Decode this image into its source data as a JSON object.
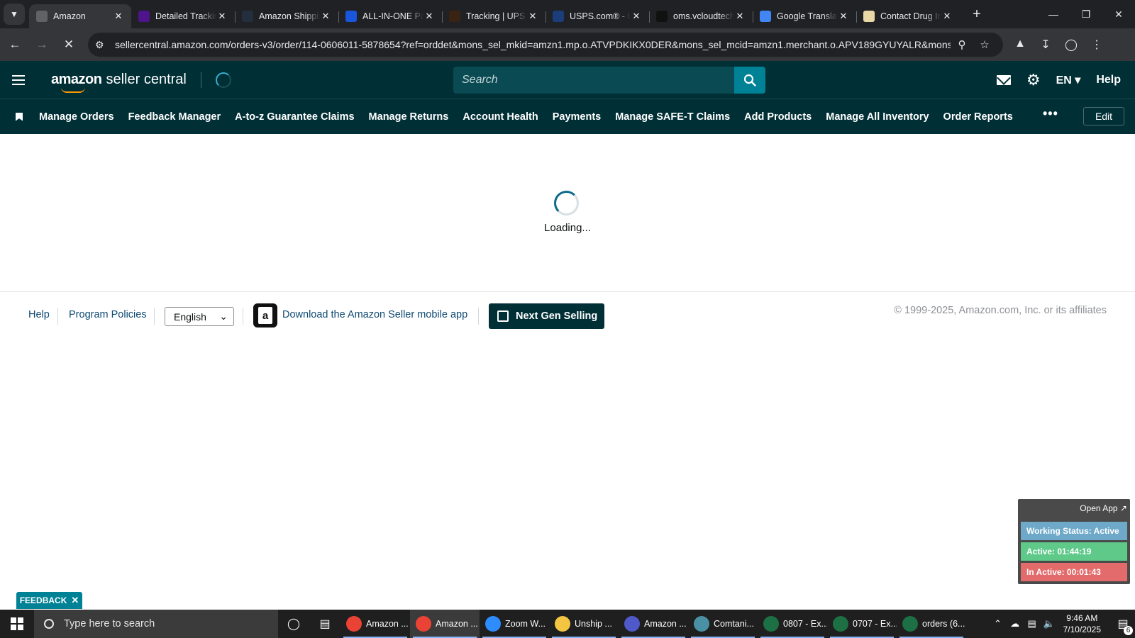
{
  "browser": {
    "tabs": [
      {
        "title": "Amazon",
        "icon": "amazon-favicon",
        "active": true
      },
      {
        "title": "Detailed Tracking",
        "icon": "fedex-favicon",
        "active": false
      },
      {
        "title": "Amazon Shipping",
        "icon": "amazon-a-favicon",
        "active": false
      },
      {
        "title": "ALL-IN-ONE Package",
        "icon": "17track-favicon",
        "active": false
      },
      {
        "title": "Tracking | UPS",
        "icon": "ups-favicon",
        "active": false
      },
      {
        "title": "USPS.com® - USPS",
        "icon": "usps-favicon",
        "active": false
      },
      {
        "title": "oms.vcloudtech",
        "icon": "oms-favicon",
        "active": false
      },
      {
        "title": "Google Translate",
        "icon": "translate-favicon",
        "active": false
      },
      {
        "title": "Contact Drug Info",
        "icon": "contact-favicon",
        "active": false
      }
    ],
    "url": "sellercentral.amazon.com/orders-v3/order/114-0606011-5878654?ref=orddet&mons_sel_mkid=amzn1.mp.o.ATVPDKIKX0DER&mons_sel_mcid=amzn1.merchant.o.APV189GYUYALR&mons_sel..."
  },
  "header": {
    "logo_brand": "amazon",
    "logo_product": "seller central",
    "search_placeholder": "Search",
    "language": "EN",
    "help": "Help"
  },
  "nav": {
    "items": [
      "Manage Orders",
      "Feedback Manager",
      "A-to-z Guarantee Claims",
      "Manage Returns",
      "Account Health",
      "Payments",
      "Manage SAFE-T Claims",
      "Add Products",
      "Manage All Inventory",
      "Order Reports"
    ],
    "more": "•••",
    "edit": "Edit"
  },
  "main": {
    "loading_text": "Loading..."
  },
  "footer": {
    "help": "Help",
    "program_policies": "Program Policies",
    "language_selected": "English",
    "download_app": "Download the Amazon Seller mobile app",
    "next_gen": "Next Gen Selling",
    "copyright": "© 1999-2025, Amazon.com, Inc. or its affiliates"
  },
  "feedback": {
    "label": "FEEDBACK"
  },
  "status_widget": {
    "open_app": "Open App ↗",
    "working_status": "Working Status: Active",
    "active": "Active: 01:44:19",
    "inactive": "In Active: 00:01:43"
  },
  "taskbar": {
    "search_placeholder": "Type here to search",
    "apps": [
      {
        "label": "Amazon ...",
        "icon": "chrome-icon",
        "color": "#ea4335",
        "active": false
      },
      {
        "label": "Amazon ...",
        "icon": "chrome-icon",
        "color": "#ea4335",
        "active": true
      },
      {
        "label": "Zoom W...",
        "icon": "zoom-icon",
        "color": "#2d8cff",
        "active": false
      },
      {
        "label": "Unship ...",
        "icon": "folder-icon",
        "color": "#f4c542",
        "active": false
      },
      {
        "label": "Amazon ...",
        "icon": "teams-icon",
        "color": "#5059c9",
        "active": false
      },
      {
        "label": "Comtani...",
        "icon": "app-icon",
        "color": "#4a90a4",
        "active": false
      },
      {
        "label": "0807 - Ex...",
        "icon": "excel-icon",
        "color": "#1d7044",
        "active": false
      },
      {
        "label": "0707 - Ex...",
        "icon": "excel-icon",
        "color": "#1d7044",
        "active": false
      },
      {
        "label": "orders (6...",
        "icon": "excel-icon",
        "color": "#1d7044",
        "active": false
      }
    ],
    "time": "9:46 AM",
    "date": "7/10/2025",
    "notifications": "6"
  }
}
